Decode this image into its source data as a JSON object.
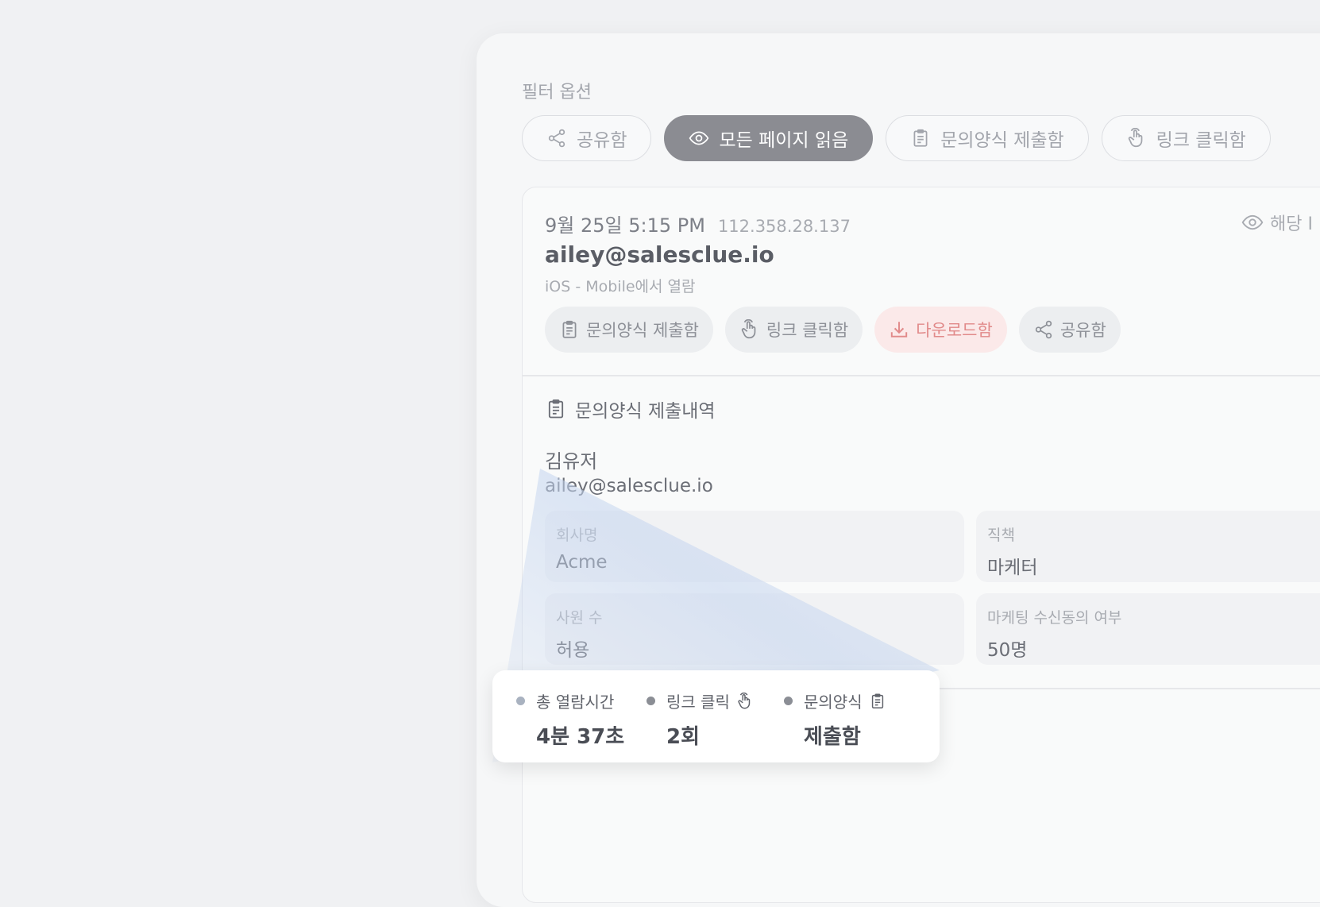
{
  "filter": {
    "title": "필터 옵션",
    "chips": [
      {
        "label": "공유함",
        "icon": "share-icon",
        "active": false
      },
      {
        "label": "모든 페이지 읽음",
        "icon": "eye-icon",
        "active": true
      },
      {
        "label": "문의양식 제출함",
        "icon": "clipboard-icon",
        "active": false
      },
      {
        "label": "링크 클릭함",
        "icon": "hand-pointer-icon",
        "active": false
      }
    ]
  },
  "activity": {
    "date": "9월 25일 5:15 PM",
    "ip": "112.358.28.137",
    "view_link": "해당 I",
    "email": "ailey@salesclue.io",
    "device": "iOS - Mobile에서 열람",
    "tags": [
      {
        "label": "문의양식 제출함",
        "icon": "clipboard-icon"
      },
      {
        "label": "링크 클릭함",
        "icon": "hand-pointer-icon"
      },
      {
        "label": "다운로드함",
        "icon": "download-icon"
      },
      {
        "label": "공유함",
        "icon": "share-icon"
      }
    ]
  },
  "submission": {
    "title": "문의양식 제출내역",
    "name": "김유저",
    "email": "ailey@salesclue.io",
    "fields": [
      {
        "label": "회사명",
        "value": "Acme"
      },
      {
        "label": "직책",
        "value": "마케터"
      },
      {
        "label": "사원 수",
        "value": "허용"
      },
      {
        "label": "마케팅 수신동의 여부",
        "value": "50명"
      }
    ]
  },
  "summary": {
    "stats": [
      {
        "label": "총 열람시간",
        "value": "4분 37초"
      },
      {
        "label": "링크 클릭",
        "value": "2회",
        "icon": "hand-pointer-icon"
      },
      {
        "label": "문의양식",
        "value": "제출함",
        "icon": "clipboard-icon"
      }
    ]
  },
  "colors": {
    "active_chip": "#8b8c92",
    "download_tag_text": "#e18a8a",
    "download_tag_bg": "#fbe9e9"
  }
}
